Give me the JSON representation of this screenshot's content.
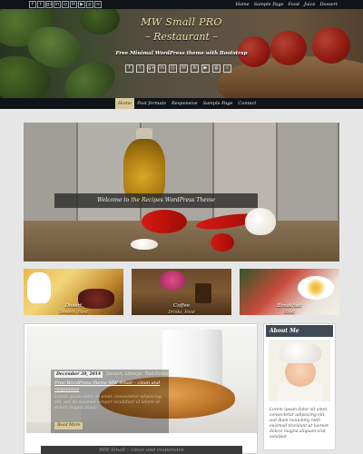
{
  "topbar": {
    "social_icons": [
      {
        "name": "facebook-icon",
        "glyph": "f"
      },
      {
        "name": "twitter-icon",
        "glyph": "t"
      },
      {
        "name": "google-plus-icon",
        "glyph": "g+"
      },
      {
        "name": "linkedin-icon",
        "glyph": "in"
      },
      {
        "name": "instagram-icon",
        "glyph": "◎"
      },
      {
        "name": "email-icon",
        "glyph": "✉"
      },
      {
        "name": "youtube-icon",
        "glyph": "▶"
      },
      {
        "name": "pinterest-icon",
        "glyph": "p"
      },
      {
        "name": "rss-icon",
        "glyph": "≋"
      }
    ],
    "menu": [
      "Home",
      "Sample Page",
      "Food",
      "Juice",
      "Dessert"
    ]
  },
  "header": {
    "title_line1": "MW Small PRO",
    "title_line2": "– Restaurant –",
    "tagline": "Free Minimal WordPress theme with Bootstrap",
    "social_icons": [
      {
        "name": "facebook-icon",
        "glyph": "f"
      },
      {
        "name": "twitter-icon",
        "glyph": "t"
      },
      {
        "name": "google-plus-icon",
        "glyph": "g+"
      },
      {
        "name": "linkedin-icon",
        "glyph": "in"
      },
      {
        "name": "instagram-icon",
        "glyph": "◎"
      },
      {
        "name": "email-icon",
        "glyph": "✉"
      },
      {
        "name": "rss-icon",
        "glyph": "≋"
      },
      {
        "name": "youtube-icon",
        "glyph": "▶"
      },
      {
        "name": "pinterest-icon",
        "glyph": "◍"
      },
      {
        "name": "search-icon",
        "glyph": "⌕"
      }
    ]
  },
  "nav": {
    "items": [
      "Home",
      "Post formats",
      "Responsive",
      "Sample Page",
      "Contact"
    ],
    "active_index": 0
  },
  "slider": {
    "caption": "Welcome to the Recipes WordPress Theme"
  },
  "featured": [
    {
      "title": "Desert",
      "meta": "Dessert, Food"
    },
    {
      "title": "Coffee",
      "meta": "Drinks, Food"
    },
    {
      "title": "Breakfast",
      "meta": "Food"
    }
  ],
  "post": {
    "date": "December 20, 2014",
    "categories": "Dessert, Lifestyle, Post Formats",
    "title": "Free WordPress theme MW Small – clean and responsive",
    "excerpt": "Lorem ipsum dolor sit amet, consectetur adipiscing elit, sed do eiusmod tempor incididunt ut labore et dolore magna aliqua.",
    "read_more": "Read More",
    "next_title": "MW Small – clean and responsive"
  },
  "sidebar": {
    "about_title": "About Me",
    "about_text": "Lorem ipsum dolor sit amet, consectetur adipiscing elit, sed diam nonummy nibh euismod tincidunt ut laoreet dolore magna aliquam erat volutpat"
  },
  "colors": {
    "topbar_bg": "#101418",
    "title_gold": "#f3e2a6",
    "nav_active": "#d8c99a",
    "sidebar_head": "#3f4a55"
  }
}
